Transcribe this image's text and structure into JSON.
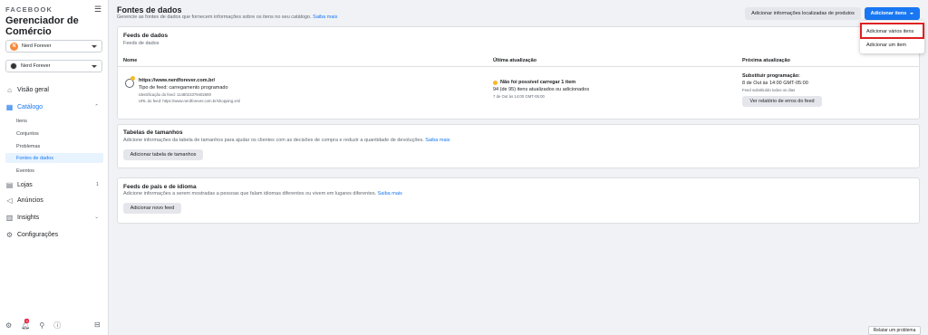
{
  "sidebar": {
    "brand": "FACEBOOK",
    "title": "Gerenciador de Comércio",
    "shop_selector": {
      "initial": "N",
      "name": "Nerd Forever"
    },
    "page_selector": {
      "name": "Nerd Forever"
    },
    "nav": {
      "overview": "Visão geral",
      "catalog": "Catálogo",
      "catalog_sub": [
        "Itens",
        "Conjuntos",
        "Problemas",
        "Fontes de dados",
        "Eventos"
      ],
      "shops": "Lojas",
      "shops_count": "1",
      "ads": "Anúncios",
      "insights": "Insights",
      "settings": "Configurações"
    },
    "notification_count": "9"
  },
  "header": {
    "title": "Fontes de dados",
    "subtitle": "Gerencie as fontes de dados que fornecem informações sobre os itens no seu catálogo.",
    "learn_more": "Saiba mais",
    "btn_add_local": "Adicionar informações localizadas de produtos",
    "btn_add_items": "Adicionar itens"
  },
  "dropdown": {
    "items": [
      "Adicionar vários itens",
      "Adicionar um item"
    ]
  },
  "feeds_card": {
    "title": "Feeds de dados",
    "subtitle": "Feeds de dados",
    "columns": [
      "Nome",
      "Última atualização",
      "Próxima atualização"
    ],
    "row": {
      "url": "https://www.nerdforever.com.br/",
      "type": "Tipo de feed: carregamento programado",
      "id": "Identificação do feed: 1148023379402690",
      "feed_url": "URL do feed: https://www.nerdforever.com.br/shopping.xml",
      "status": "Não foi possível carregar 1 item",
      "status_detail": "94 (de 95) itens atualizados ou adicionados",
      "last_date": "7 de Out às 14:00 GMT-05:00",
      "next_label": "Substituir programação:",
      "next_date": "8 de Out às 14:00 GMT-05:00",
      "next_freq": "Feed substituído todos os dias",
      "error_btn": "Ver relatório de erros do feed"
    }
  },
  "sizes_card": {
    "title": "Tabelas de tamanhos",
    "subtitle": "Adicione informações da tabela de tamanhos para ajudar os clientes com as decisões de compra e reduzir a quantidade de devoluções.",
    "learn_more": "Saiba mais",
    "btn": "Adicionar tabela de tamanhos"
  },
  "country_card": {
    "title": "Feeds de país e de idioma",
    "subtitle": "Adicione informações a serem mostradas a pessoas que falam idiomas diferentes ou vivem em lugares diferentes.",
    "learn_more": "Saiba mais",
    "btn": "Adicionar novo feed"
  },
  "footer": {
    "report": "Relatar um problema"
  }
}
